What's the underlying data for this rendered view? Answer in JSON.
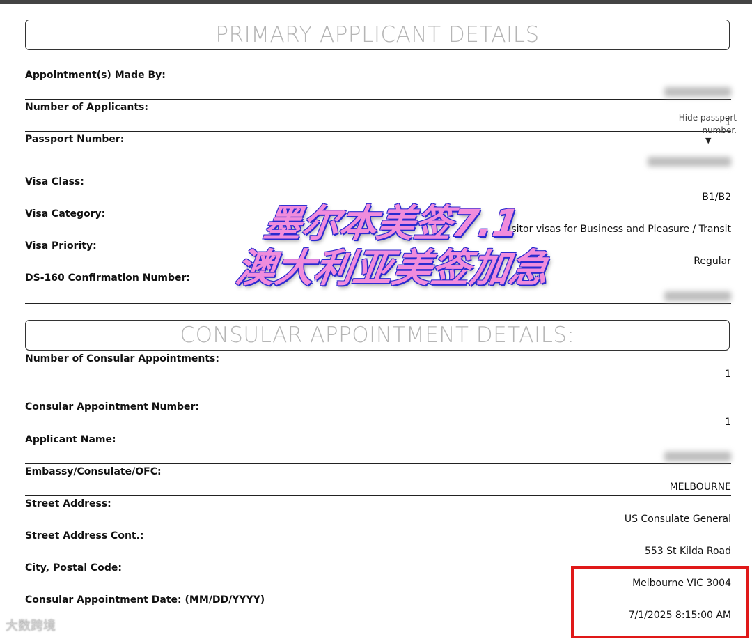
{
  "primary_section": {
    "title": "PRIMARY APPLICANT DETAILS"
  },
  "primary_rows": [
    {
      "label": "Appointment(s) Made By:",
      "value": ""
    },
    {
      "label": "Number of Applicants:",
      "value": "1"
    },
    {
      "label": "Passport Number:",
      "value": ""
    },
    {
      "label": "Visa Class:",
      "value": "B1/B2"
    },
    {
      "label": "Visa Category:",
      "value": "Visitor visas for Business and Pleasure / Transit"
    },
    {
      "label": "Visa Priority:",
      "value": "Regular"
    },
    {
      "label": "DS-160 Confirmation Number:",
      "value": ""
    }
  ],
  "hide_passport": {
    "label": "Hide passport number.",
    "arrow": "▼"
  },
  "consular_section": {
    "title": "CONSULAR APPOINTMENT DETAILS:"
  },
  "consular_rows": [
    {
      "label": "Number of Consular Appointments:",
      "value": "1"
    },
    {
      "label": "Consular Appointment Number:",
      "value": "1"
    },
    {
      "label": "Applicant Name:",
      "value": ""
    },
    {
      "label": "Embassy/Consulate/OFC:",
      "value": "MELBOURNE"
    },
    {
      "label": "Street Address:",
      "value": "US Consulate General"
    },
    {
      "label": "Street Address Cont.:",
      "value": "553 St Kilda Road"
    },
    {
      "label": "City, Postal Code:",
      "value": "Melbourne VIC 3004"
    },
    {
      "label": "Consular Appointment Date: (MM/DD/YYYY)",
      "value": "7/1/2025 8:15:00 AM"
    }
  ],
  "watermark": {
    "line1": "墨尔本美签7.1",
    "line2": "澳大利亚美签加急"
  },
  "corner_logo": {
    "text": "大数跨境"
  },
  "colors": {
    "highlight_box": "#e01818",
    "watermark_fill": "#f08cdc",
    "watermark_outline": "#2a2ad0"
  }
}
